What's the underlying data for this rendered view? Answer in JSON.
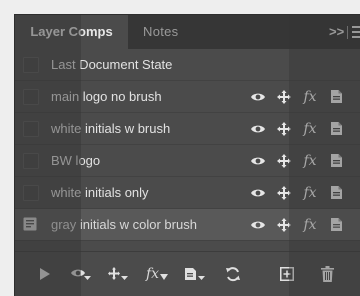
{
  "tabs": {
    "active": "Layer Comps",
    "second": "Notes",
    "overflow": ">>"
  },
  "comps": [
    {
      "name": "Last Document State",
      "settings_icons": false,
      "selected": false
    },
    {
      "name": "main logo no brush",
      "settings_icons": true,
      "selected": false
    },
    {
      "name": "white initials w brush",
      "settings_icons": true,
      "selected": false
    },
    {
      "name": "BW logo",
      "settings_icons": true,
      "selected": false
    },
    {
      "name": "white initials only",
      "settings_icons": true,
      "selected": false
    },
    {
      "name": "gray initials w color brush",
      "settings_icons": true,
      "selected": true
    }
  ],
  "icons": {
    "visibility": "eye-icon",
    "position": "move-arrows-icon",
    "fx_label": "fx",
    "appearance": "page-icon"
  },
  "toolbar": [
    "play-icon",
    "apply-visibility-icon",
    "apply-position-icon",
    "apply-appearance-fx-icon",
    "apply-smart-object-icon",
    "update-icon",
    "new-comp-icon",
    "trash-icon"
  ],
  "colors": {
    "panel": "#4b4b4b",
    "tabbar": "#363636",
    "selected_row": "#595959",
    "text": "#e2e2e2"
  }
}
